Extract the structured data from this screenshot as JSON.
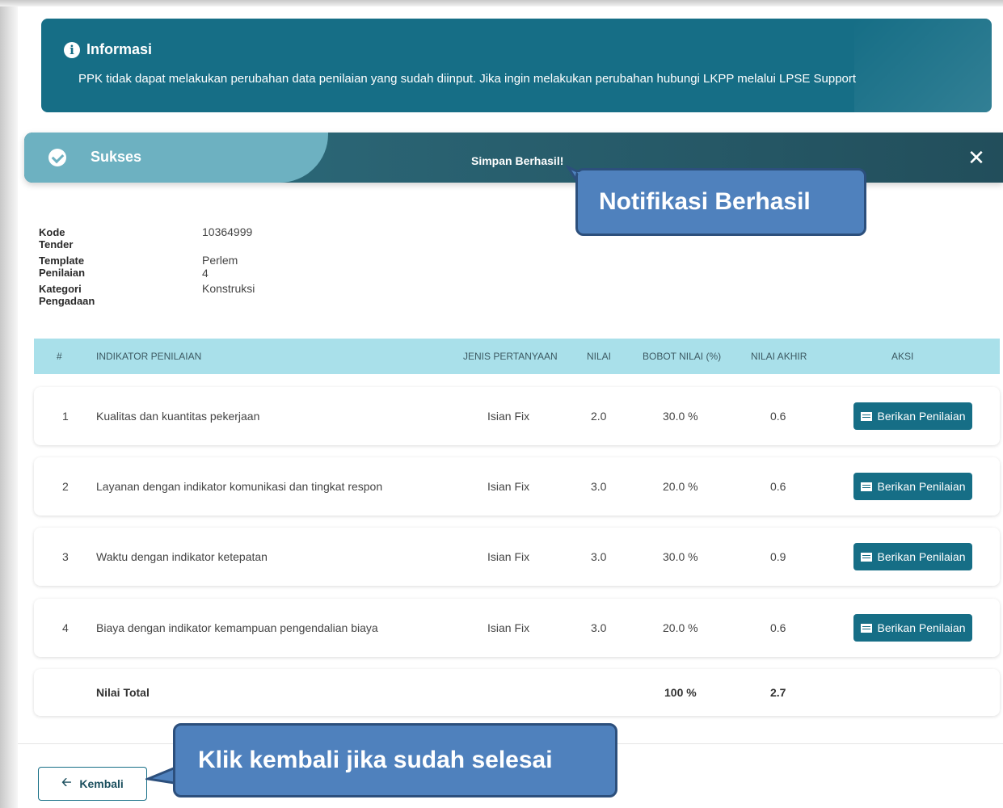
{
  "info": {
    "title": "Informasi",
    "message": "PPK tidak dapat melakukan perubahan data penilaian yang sudah diinput. Jika ingin melakukan perubahan hubungi LKPP melalui LPSE Support"
  },
  "alert": {
    "title": "Sukses",
    "message": "Simpan Berhasil!",
    "close_symbol": "✕"
  },
  "callouts": {
    "notification": "Notifikasi Berhasil",
    "back_hint": "Klik kembali jika sudah selesai"
  },
  "details": [
    {
      "label": "Kode Tender",
      "value": "10364999"
    },
    {
      "label": "Template Penilaian",
      "value": "Perlem 4"
    },
    {
      "label": "Kategori Pengadaan",
      "value": "Konstruksi"
    }
  ],
  "table": {
    "headers": {
      "no": "#",
      "indicator": "INDIKATOR PENILAIAN",
      "type": "JENIS PERTANYAAN",
      "score": "NILAI",
      "weight": "BOBOT NILAI (%)",
      "final": "NILAI AKHIR",
      "action": "AKSI"
    },
    "rows": [
      {
        "no": "1",
        "indicator": "Kualitas dan kuantitas pekerjaan",
        "type": "Isian Fix",
        "score": "2.0",
        "weight": "30.0 %",
        "final": "0.6",
        "action": "Berikan Penilaian"
      },
      {
        "no": "2",
        "indicator": "Layanan dengan indikator komunikasi dan tingkat respon",
        "type": "Isian Fix",
        "score": "3.0",
        "weight": "20.0 %",
        "final": "0.6",
        "action": "Berikan Penilaian"
      },
      {
        "no": "3",
        "indicator": "Waktu dengan indikator ketepatan",
        "type": "Isian Fix",
        "score": "3.0",
        "weight": "30.0 %",
        "final": "0.9",
        "action": "Berikan Penilaian"
      },
      {
        "no": "4",
        "indicator": "Biaya dengan indikator kemampuan pengendalian biaya",
        "type": "Isian Fix",
        "score": "3.0",
        "weight": "20.0 %",
        "final": "0.6",
        "action": "Berikan Penilaian"
      }
    ],
    "total": {
      "label": "Nilai Total",
      "weight": "100 %",
      "final": "2.7"
    }
  },
  "back_button": {
    "label": "Kembali",
    "icon": "arrow-left-icon"
  },
  "colors": {
    "primary": "#166e86",
    "success_light": "#6db1c1",
    "header_bg": "#a9e0ea",
    "callout": "#4f81bd"
  }
}
